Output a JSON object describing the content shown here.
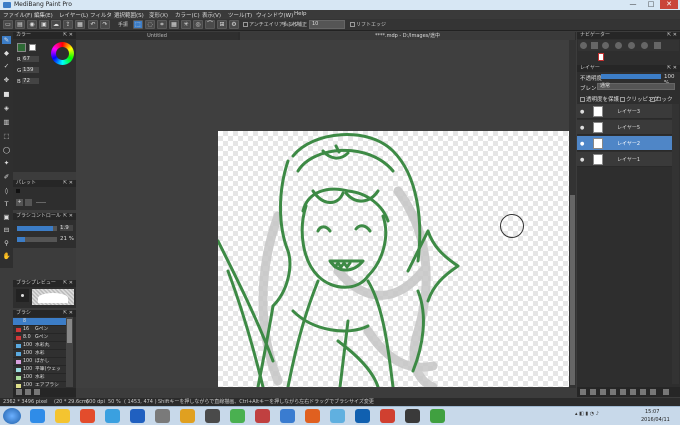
{
  "app": {
    "title": "MediBang Paint Pro"
  },
  "window_controls": {
    "minimize": "—",
    "maximize": "□",
    "close": "✕"
  },
  "menu": [
    "ファイル(F)",
    "編集(E)",
    "レイヤー(L)",
    "フィルタ",
    "選択範囲(S)",
    "変形(X)",
    "カラー(C)",
    "表示(V)",
    "ツール(T)",
    "ウィンドウ(W)",
    "Help"
  ],
  "toolbar": {
    "undo": "↶",
    "redo": "↷",
    "hand_label": "手振",
    "antialias_label": "アンチエイリアシング",
    "blur_label": "手ぶれ補正",
    "blur_value": "10",
    "ruler_label": "リフトエッジ"
  },
  "doc_tabs": [
    "Untitled",
    "****.mdp - D:/Images/途中"
  ],
  "color_panel": {
    "title": "カラー",
    "r_label": "R",
    "r_value": "67",
    "g_label": "G",
    "g_value": "139",
    "b_label": "B",
    "b_value": "72",
    "main_color": "#2e6a35"
  },
  "palette_panel": {
    "title": "パレット",
    "add_label": "+",
    "name": "-----"
  },
  "brush_control": {
    "title": "ブラシコントロール",
    "size": "1.9",
    "opacity": "21 %",
    "size_fill": 0.9,
    "opacity_fill": 0.21
  },
  "brush_preview": {
    "title": "ブラシプレビュー"
  },
  "brush_panel": {
    "title": "ブラシ",
    "items": [
      {
        "size": "8",
        "name": "",
        "color": "#3c7dc7"
      },
      {
        "size": "16",
        "name": "Gペン",
        "color": "#d03838"
      },
      {
        "size": "8.0",
        "name": "Gペン",
        "color": "#d03838"
      },
      {
        "size": "100",
        "name": "水彩丸",
        "color": "#5aaae0"
      },
      {
        "size": "100",
        "name": "水彩",
        "color": "#5aaae0"
      },
      {
        "size": "100",
        "name": "ぼかし",
        "color": "#d7a0dd"
      },
      {
        "size": "100",
        "name": "平筆(ウェット)",
        "color": "#9adbe0"
      },
      {
        "size": "100",
        "name": "水彩",
        "color": "#aee0a0"
      },
      {
        "size": "100",
        "name": "エアブラシ",
        "color": "#e0e08a"
      }
    ]
  },
  "navigator": {
    "title": "ナビゲーター"
  },
  "layer_panel": {
    "title": "レイヤー",
    "opacity_label": "不透明度",
    "opacity_value": "100 %",
    "opacity_fill": 1.0,
    "blend_label": "ブレンド",
    "blend_value": "通常",
    "protect_label": "透明度を保護",
    "clipping_label": "クリッピング",
    "lock_label": "ロック",
    "layers": [
      {
        "name": "レイヤー3",
        "selected": false
      },
      {
        "name": "レイヤー5",
        "selected": false
      },
      {
        "name": "レイヤー2",
        "selected": true
      },
      {
        "name": "レイヤー1",
        "selected": false
      }
    ]
  },
  "status": {
    "size": "2362 * 3496 pixel",
    "cm": "(20 * 29.6cm)",
    "dpi": "600 dpi",
    "zoom": "50 %",
    "coords": "( 1453, 474 )",
    "hint": "Shiftキーを押しながらで直線描画、Ctrl+Altキーを押しながら左右ドラッグでブラシサイズ変更"
  },
  "taskbar": {
    "time": "15:07",
    "date": "2016/04/11",
    "apps": [
      "#2f8ce8",
      "#f4c430",
      "#e34c2c",
      "#3aa0e0",
      "#2060c0",
      "#7a7a7a",
      "#e0a020",
      "#4a4a4a",
      "#4ab050",
      "#c04040",
      "#3a7cd0",
      "#e06020",
      "#60b0e0",
      "#1060b0",
      "#d04030",
      "#3a3a3a",
      "#40a040"
    ]
  },
  "colors": {
    "accent": "#3c7dc7",
    "stroke": "#3d8a45",
    "sketch": "#c8c8c8"
  }
}
